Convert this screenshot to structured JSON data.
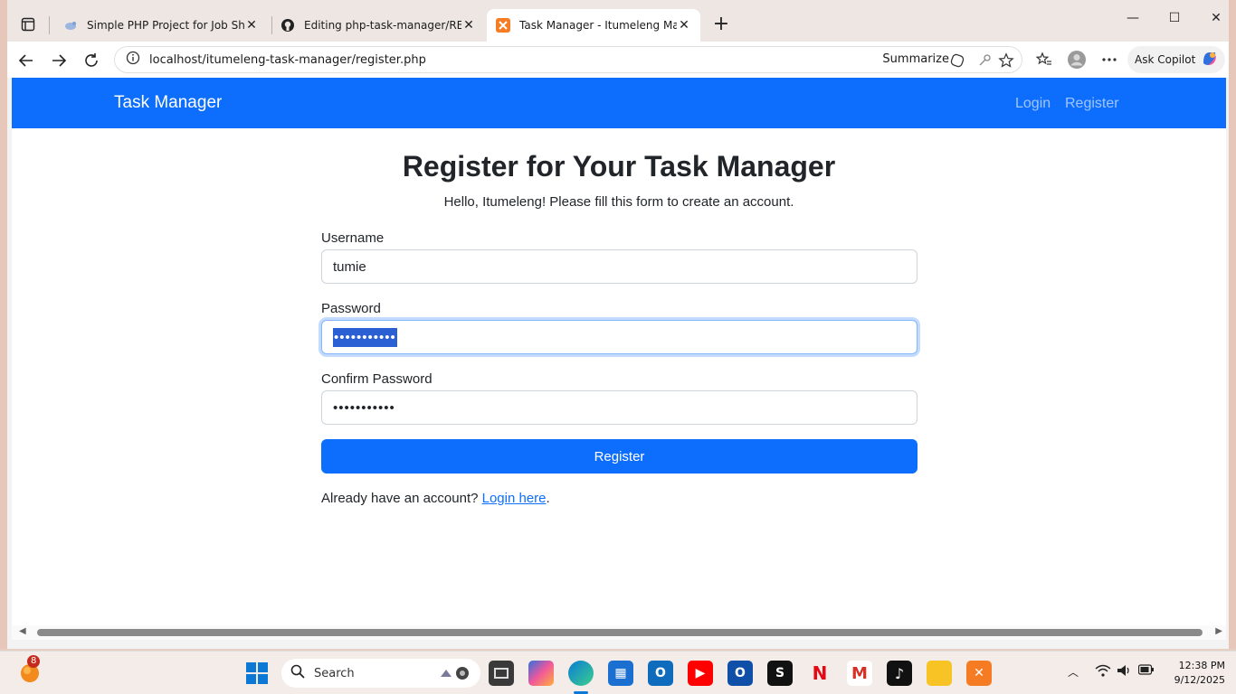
{
  "browser": {
    "tabs": [
      {
        "title": "Simple PHP Project for Job Showc",
        "active": false
      },
      {
        "title": "Editing php-task-manager/READM",
        "active": false
      },
      {
        "title": "Task Manager - Itumeleng Mahar",
        "active": true
      }
    ],
    "url": "localhost/itumeleng-task-manager/register.php",
    "summarize_label": "Summarize",
    "copilot_label": "Ask Copilot"
  },
  "page": {
    "brand": "Task Manager",
    "nav": {
      "login": "Login",
      "register": "Register"
    },
    "heading": "Register for Your Task Manager",
    "subheading": "Hello, Itumeleng! Please fill this form to create an account.",
    "form": {
      "username_label": "Username",
      "username_value": "tumie",
      "password_label": "Password",
      "password_value": "•••••••••••",
      "confirm_label": "Confirm Password",
      "confirm_value": "•••••••••••",
      "submit_label": "Register"
    },
    "footer_text": "Already have an account?",
    "login_link": "Login here",
    "footer_period": "."
  },
  "taskbar": {
    "notification_count": "8",
    "search_placeholder": "Search",
    "time": "12:38 PM",
    "date": "9/12/2025"
  },
  "colors": {
    "primary": "#0d6efd",
    "navbar_link": "rgba(255,255,255,0.6)"
  }
}
